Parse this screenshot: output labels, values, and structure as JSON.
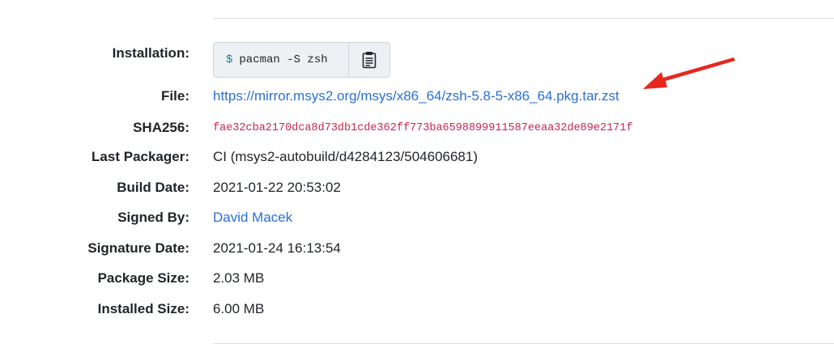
{
  "labels": {
    "installation": "Installation:",
    "file": "File:",
    "sha256": "SHA256:",
    "last_packager": "Last Packager:",
    "build_date": "Build Date:",
    "signed_by": "Signed By:",
    "signature_date": "Signature Date:",
    "package_size": "Package Size:",
    "installed_size": "Installed Size:"
  },
  "installation": {
    "prompt": "$",
    "command": "pacman -S zsh",
    "copy_icon": "clipboard-icon"
  },
  "file_url": "https://mirror.msys2.org/msys/x86_64/zsh-5.8-5-x86_64.pkg.tar.zst",
  "sha256": "fae32cba2170dca8d73db1cde362ff773ba6598899911587eeaa32de89e2171f",
  "last_packager": "CI (msys2-autobuild/d4284123/504606681)",
  "build_date": "2021-01-22 20:53:02",
  "signed_by": "David Macek",
  "signature_date": "2021-01-24 16:13:54",
  "package_size": "2.03 MB",
  "installed_size": "6.00 MB",
  "colors": {
    "link": "#2a6fd6",
    "hash": "#c7254e",
    "annotation_arrow": "#e8281e"
  }
}
